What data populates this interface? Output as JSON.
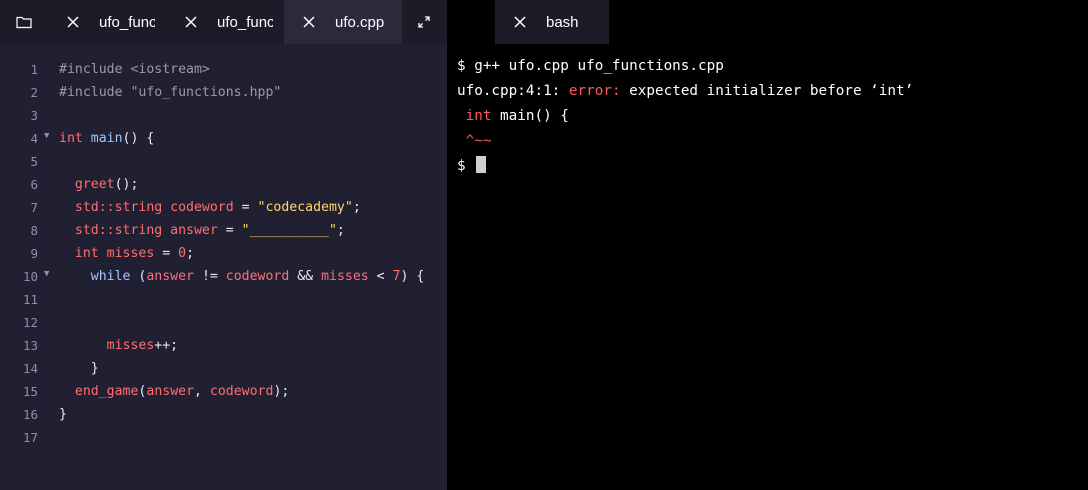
{
  "tabs": {
    "editor": [
      {
        "label": "ufo_functions.hpp",
        "active": false
      },
      {
        "label": "ufo_functions.cpp",
        "active": false
      },
      {
        "label": "ufo.cpp",
        "active": true
      }
    ],
    "terminal": [
      {
        "label": "bash"
      }
    ]
  },
  "icons": {
    "folder": "folder-icon",
    "close": "close-icon",
    "expand": "expand-icon"
  },
  "code": {
    "line_numbers": [
      "1",
      "2",
      "3",
      "4",
      "5",
      "6",
      "7",
      "8",
      "9",
      "10",
      "11",
      "12",
      "13",
      "14",
      "15",
      "16",
      "17"
    ],
    "l1_directive": "#include",
    "l1_header": " <iostream>",
    "l2_directive": "#include",
    "l2_header": " \"ufo_functions.hpp\"",
    "l4_int": "int",
    "l4_main": " main",
    "l4_rest": "() {",
    "l6_call": "greet",
    "l6_rest": "();",
    "l7_type": "std::string",
    "l7_name": " codeword",
    "l7_eq": " = ",
    "l7_val": "\"codecademy\"",
    "l7_end": ";",
    "l8_type": "std::string",
    "l8_name": " answer",
    "l8_eq": " = ",
    "l8_val": "\"__________\"",
    "l8_end": ";",
    "l9_int": "int",
    "l9_name": " misses",
    "l9_eq": " = ",
    "l9_val": "0",
    "l9_end": ";",
    "l10_while": "while",
    "l10_open": " (",
    "l10_a": "answer",
    "l10_ne": " != ",
    "l10_b": "codeword",
    "l10_and": " && ",
    "l10_c": "misses",
    "l10_lt": " < ",
    "l10_n": "7",
    "l10_close": ") {",
    "l13_var": "misses",
    "l13_op": "++;",
    "l14_brace": "}",
    "l15_call": "end_game",
    "l15_open": "(",
    "l15_a": "answer",
    "l15_comma": ", ",
    "l15_b": "codeword",
    "l15_close": ");",
    "l16_brace": "}"
  },
  "terminal": {
    "cmd": "$ g++ ufo.cpp ufo_functions.cpp",
    "err_loc": "ufo.cpp:4:1: ",
    "err_word": "error:",
    "err_msg": " expected initializer before ‘int’",
    "src_int": " int",
    "src_rest": " main() {",
    "caret": " ^~~",
    "prompt": "$ "
  }
}
